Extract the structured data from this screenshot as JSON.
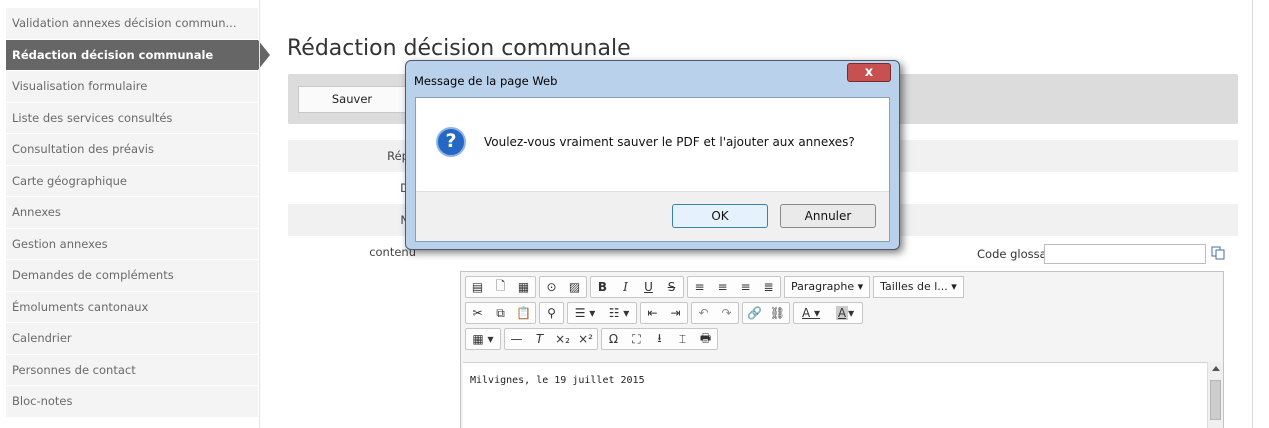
{
  "sidebar": {
    "items": [
      {
        "label": "Validation annexes décision commun..."
      },
      {
        "label": "Rédaction décision communale",
        "active": true
      },
      {
        "label": "Visualisation formulaire"
      },
      {
        "label": "Liste des services consultés"
      },
      {
        "label": "Consultation des préavis"
      },
      {
        "label": "Carte géographique"
      },
      {
        "label": "Annexes"
      },
      {
        "label": "Gestion annexes"
      },
      {
        "label": "Demandes de compléments"
      },
      {
        "label": "Émoluments cantonaux"
      },
      {
        "label": "Calendrier"
      },
      {
        "label": "Personnes de contact"
      },
      {
        "label": "Bloc-notes"
      }
    ]
  },
  "main": {
    "title": "Rédaction décision communale",
    "save_label": "Sauver",
    "form_labels": [
      "Répo",
      "Da",
      "No",
      "contenu"
    ],
    "glossaire_label": "Code glossaire:",
    "glossaire_value": ""
  },
  "editor": {
    "paragraph_combo": "Paragraphe",
    "size_combo": "Tailles de l...",
    "content": "Milvignes, le 19 juillet 2015"
  },
  "dialog": {
    "title": "Message de la page Web",
    "message": "Voulez-vous vraiment sauver le PDF et l'ajouter aux annexes?",
    "ok_label": "OK",
    "cancel_label": "Annuler",
    "icon": "question-icon",
    "close_glyph": "x"
  },
  "colors": {
    "active_sidebar": "#666666",
    "toolbar_bg": "#dcdcdc",
    "dialog_frame": "#b9d1ea",
    "close_button": "#c75050"
  }
}
